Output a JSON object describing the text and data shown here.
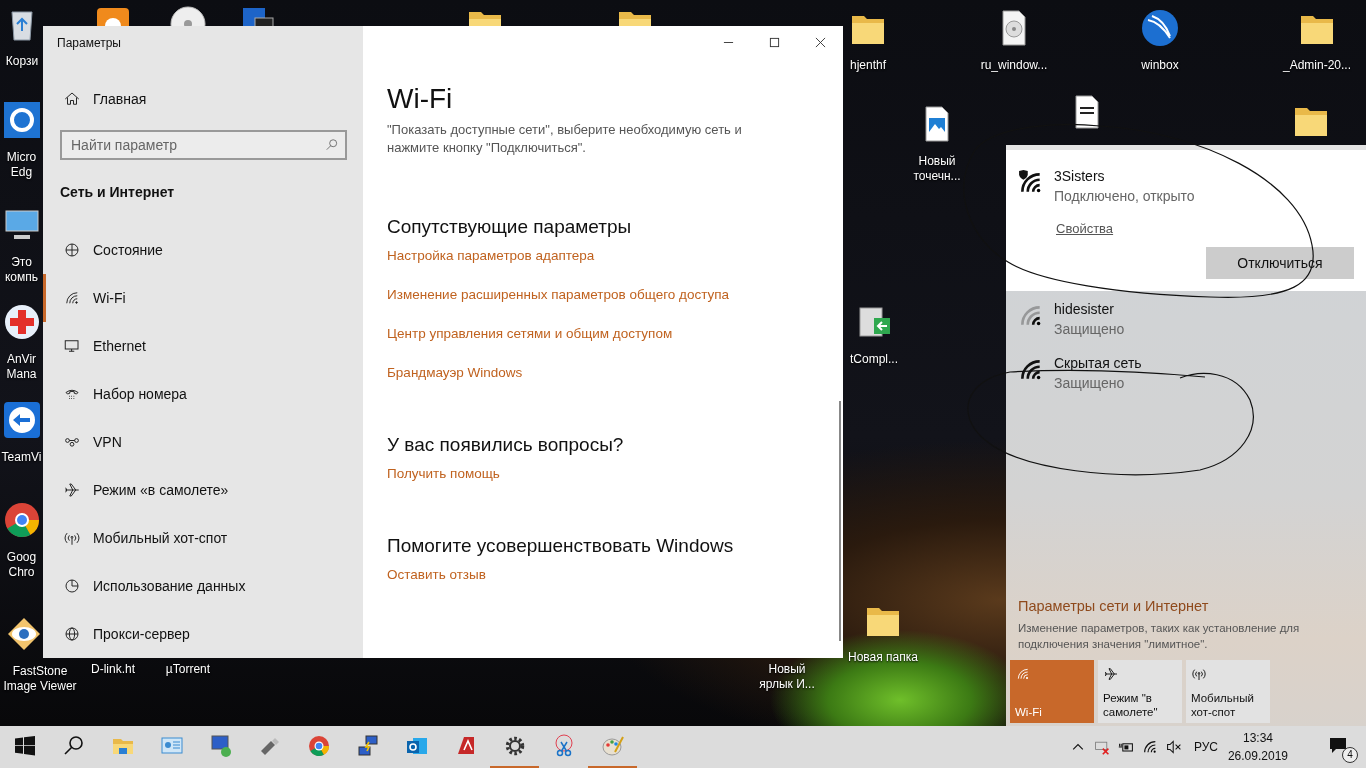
{
  "desktop": {
    "icons": [
      {
        "kind": "bin",
        "label": "Корзи"
      },
      {
        "kind": "edge",
        "label": "Micro Edg"
      },
      {
        "kind": "computer",
        "label": "Это компь"
      },
      {
        "kind": "anvir",
        "label": "AnVir Mana"
      },
      {
        "kind": "teamviewer",
        "label": "TeamVi"
      },
      {
        "kind": "chrome",
        "label": "Goog Chro"
      },
      {
        "kind": "faststone",
        "label": "FastStone Image Viewer"
      },
      {
        "kind": "app"
      },
      {
        "kind": "disc"
      },
      {
        "kind": "app2"
      },
      {
        "kind": "folder"
      },
      {
        "kind": "folder"
      },
      {
        "kind": "folder",
        "label": "hjenthf"
      },
      {
        "kind": "discfile",
        "label": "ru_window..."
      },
      {
        "kind": "globe",
        "label": "winbox"
      },
      {
        "kind": "folder",
        "label": "_Admin-20..."
      },
      {
        "kind": "imagefile",
        "label": "Новый точечн..."
      },
      {
        "kind": "document"
      },
      {
        "kind": "folder"
      },
      {
        "kind": "shortcut",
        "label": "tCompl..."
      },
      {
        "kind": "none",
        "label": "D-link.ht"
      },
      {
        "kind": "none",
        "label": "µTorrent"
      },
      {
        "kind": "none",
        "label": "Новый ярлык И..."
      },
      {
        "kind": "folder",
        "label": "Новая папка"
      }
    ]
  },
  "settings_window": {
    "title": "Параметры",
    "home": "Главная",
    "search": {
      "placeholder": "Найти параметр"
    },
    "section": "Сеть и Интернет",
    "nav": [
      {
        "label": "Состояние",
        "selected": false
      },
      {
        "label": "Wi-Fi",
        "selected": true
      },
      {
        "label": "Ethernet",
        "selected": false
      },
      {
        "label": "Набор номера",
        "selected": false
      },
      {
        "label": "VPN",
        "selected": false
      },
      {
        "label": "Режим «в самолете»",
        "selected": false
      },
      {
        "label": "Мобильный хот-спот",
        "selected": false
      },
      {
        "label": "Использование данных",
        "selected": false
      },
      {
        "label": "Прокси-сервер",
        "selected": false
      }
    ],
    "page": {
      "title": "Wi-Fi",
      "description": "\"Показать доступные сети\", выберите необходимую сеть и нажмите кнопку \"Подключиться\".",
      "sections": [
        {
          "heading": "Сопутствующие параметры",
          "links": [
            "Настройка параметров адаптера",
            "Изменение расширенных параметров общего доступа",
            "Центр управления сетями и общим доступом",
            "Брандмауэр Windows"
          ]
        },
        {
          "heading": "У вас появились вопросы?",
          "links": [
            "Получить помощь"
          ]
        },
        {
          "heading": "Помогите усовершенствовать Windows",
          "links": [
            "Оставить отзыв"
          ]
        }
      ]
    }
  },
  "network_flyout": {
    "networks": [
      {
        "name": "3Sisters",
        "status": "Подключено, открыто",
        "connected": true,
        "shield": true,
        "weak": false,
        "properties_link": "Свойства",
        "button": "Отключиться"
      },
      {
        "name": "hidesister",
        "status": "Защищено",
        "connected": false,
        "shield": false,
        "weak": true
      },
      {
        "name": "Скрытая сеть",
        "status": "Защищено",
        "connected": false,
        "shield": false,
        "weak": false
      }
    ],
    "settings_link": "Параметры сети и Интернет",
    "settings_hint": "Изменение параметров, таких как установление для подключения значения \"лимитное\".",
    "tiles": [
      {
        "label": "Wi-Fi",
        "on": true
      },
      {
        "label": "Режим \"в самолете\"",
        "on": false
      },
      {
        "label": "Мобильный хот-спот",
        "on": false
      }
    ]
  },
  "taskbar": {
    "apps": [
      {
        "kind": "start",
        "running": false
      },
      {
        "kind": "search",
        "running": false
      },
      {
        "kind": "explorer",
        "running": false
      },
      {
        "kind": "control",
        "running": false
      },
      {
        "kind": "remote",
        "running": false
      },
      {
        "kind": "usb",
        "running": false
      },
      {
        "kind": "chrome",
        "running": false
      },
      {
        "kind": "putty",
        "running": false
      },
      {
        "kind": "outlook",
        "running": false
      },
      {
        "kind": "autocad",
        "running": false
      },
      {
        "kind": "settings",
        "running": true
      },
      {
        "kind": "snipping",
        "running": false
      },
      {
        "kind": "paint",
        "running": true
      }
    ],
    "tray": {
      "language": "РУС",
      "time": "13:34",
      "date": "26.09.2019",
      "notifications": "4"
    }
  }
}
